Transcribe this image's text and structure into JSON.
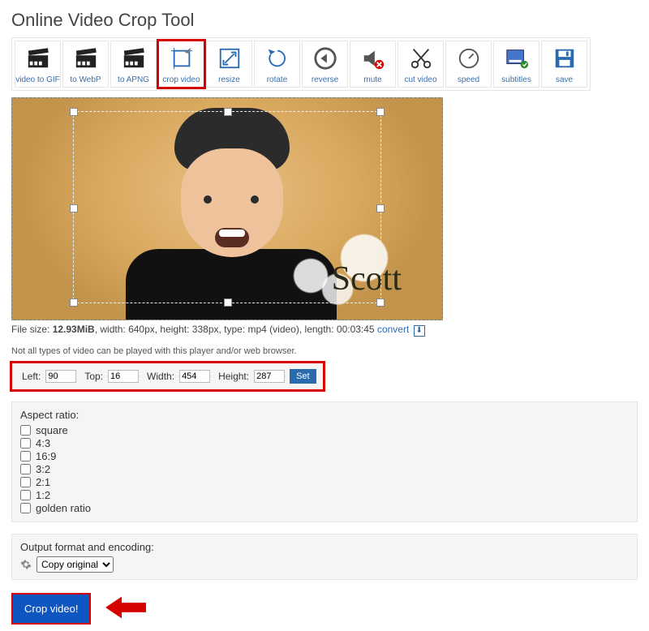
{
  "title": "Online Video Crop Tool",
  "toolbar": [
    {
      "id": "video-to-gif",
      "label": "video to GIF"
    },
    {
      "id": "to-webp",
      "label": "to WebP"
    },
    {
      "id": "to-apng",
      "label": "to APNG"
    },
    {
      "id": "crop-video",
      "label": "crop video",
      "selected": true
    },
    {
      "id": "resize",
      "label": "resize"
    },
    {
      "id": "rotate",
      "label": "rotate"
    },
    {
      "id": "reverse",
      "label": "reverse"
    },
    {
      "id": "mute",
      "label": "mute"
    },
    {
      "id": "cut-video",
      "label": "cut video"
    },
    {
      "id": "speed",
      "label": "speed"
    },
    {
      "id": "subtitles",
      "label": "subtitles"
    },
    {
      "id": "save",
      "label": "save"
    }
  ],
  "watermark": "Scott",
  "meta": {
    "prefix": "File size: ",
    "size": "12.93MiB",
    "rest": ", width: 640px, height: 338px, type: mp4 (video), length: 00:03:45",
    "convert": "convert"
  },
  "note": "Not all types of video can be played with this player and/or web browser.",
  "coords": {
    "left_label": "Left:",
    "left": "90",
    "top_label": "Top:",
    "top": "16",
    "width_label": "Width:",
    "width": "454",
    "height_label": "Height:",
    "height": "287",
    "set": "Set"
  },
  "aspect": {
    "title": "Aspect ratio:",
    "options": [
      "square",
      "4:3",
      "16:9",
      "3:2",
      "2:1",
      "1:2",
      "golden ratio"
    ]
  },
  "output": {
    "title": "Output format and encoding:",
    "value": "Copy original"
  },
  "crop_button": "Crop video!"
}
